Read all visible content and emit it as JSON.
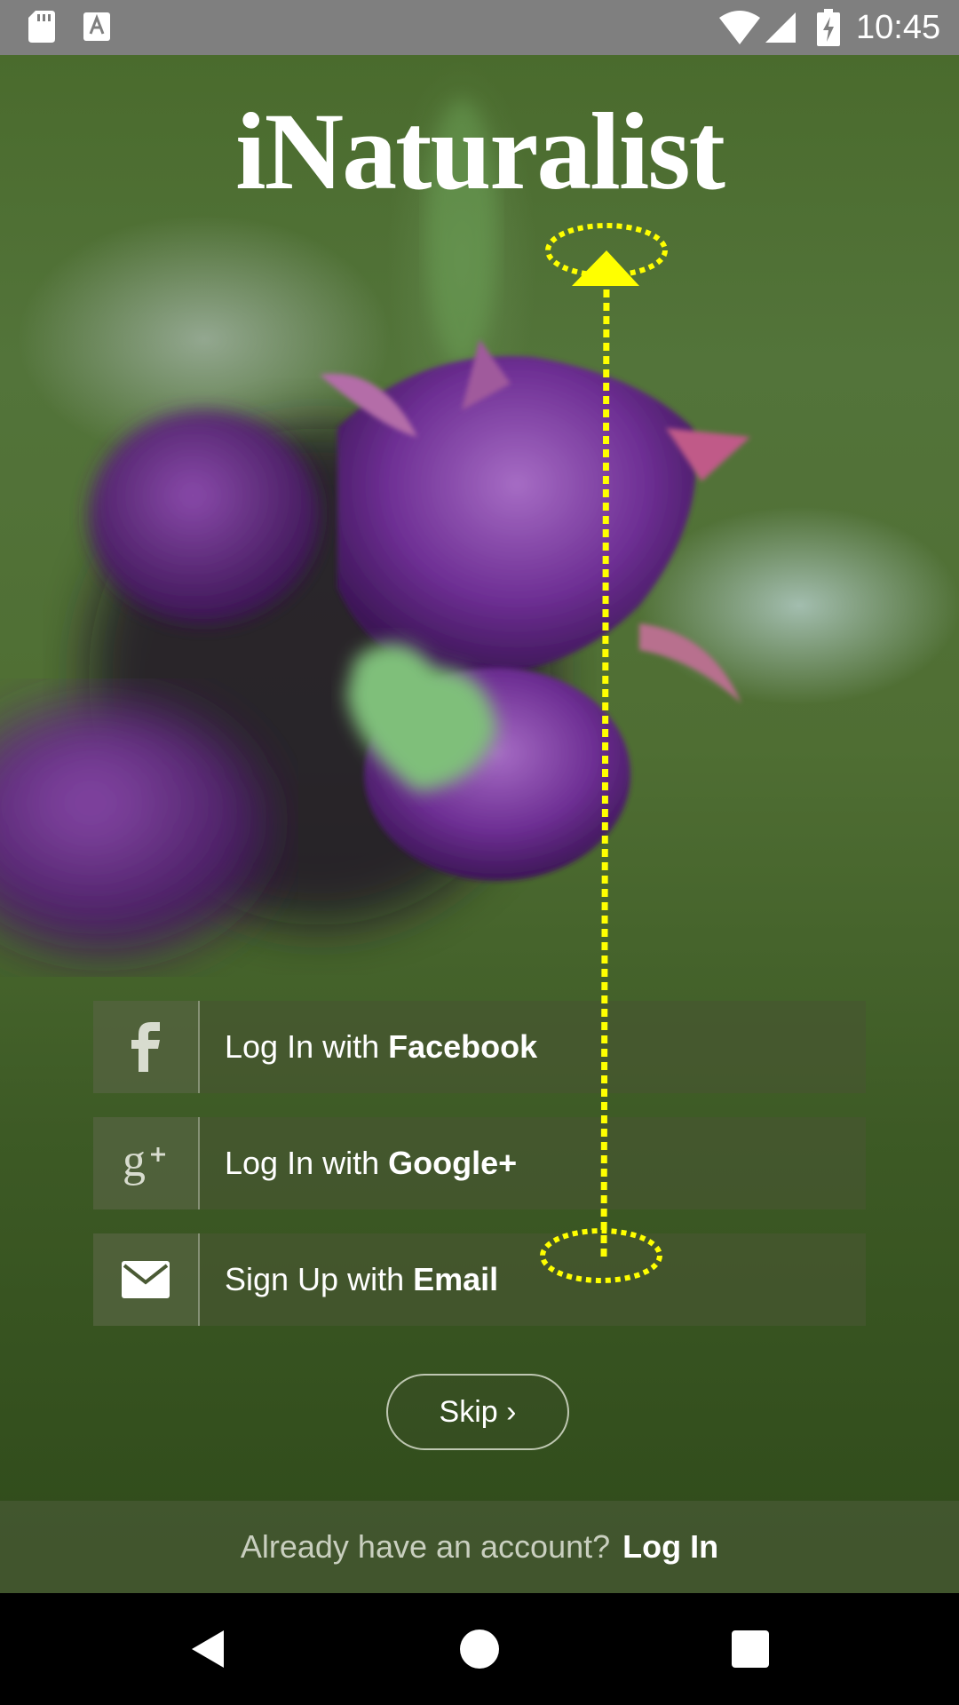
{
  "status_bar": {
    "time": "10:45",
    "icons": [
      "sd-card-icon",
      "a-notification-icon",
      "wifi-icon",
      "signal-icon",
      "battery-charging-icon"
    ]
  },
  "app": {
    "logo_text": "iNaturalist"
  },
  "login_buttons": {
    "facebook": {
      "prefix": "Log In with ",
      "provider": "Facebook",
      "icon": "facebook-icon"
    },
    "google": {
      "prefix": "Log In with ",
      "provider": "Google+",
      "icon": "google-plus-icon"
    },
    "email": {
      "prefix": "Sign Up with ",
      "provider": "Email",
      "icon": "envelope-icon"
    }
  },
  "skip": {
    "label": "Skip ›"
  },
  "footer": {
    "question": "Already have an account?",
    "link": "Log In"
  },
  "colors": {
    "status_bar": "#7f7f7f",
    "button_bg": "#465630",
    "gesture_annotation": "#ffff00"
  },
  "nav_bar": {
    "icons": [
      "back-icon",
      "home-icon",
      "recents-icon"
    ]
  }
}
